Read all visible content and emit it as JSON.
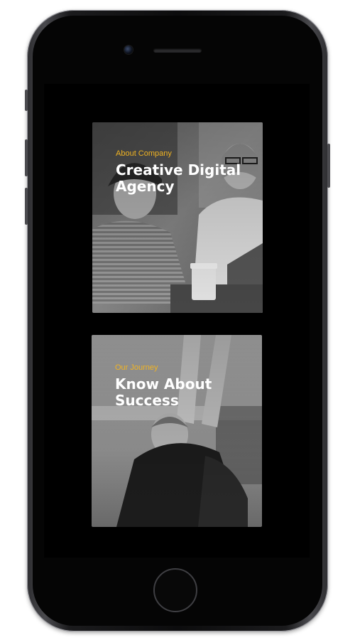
{
  "device": {
    "type": "iPhone",
    "frame_color": "#1a1a1c"
  },
  "cards": [
    {
      "subtitle": "About Company",
      "title": "Creative Digital Agency",
      "subtitle_color": "#f0b322",
      "image": "grayscale photo of two women working at laptops"
    },
    {
      "subtitle": "Our Journey",
      "title": "Know About Success",
      "subtitle_color": "#f0b322",
      "image": "grayscale photo of a smiling man raising his arms"
    }
  ]
}
